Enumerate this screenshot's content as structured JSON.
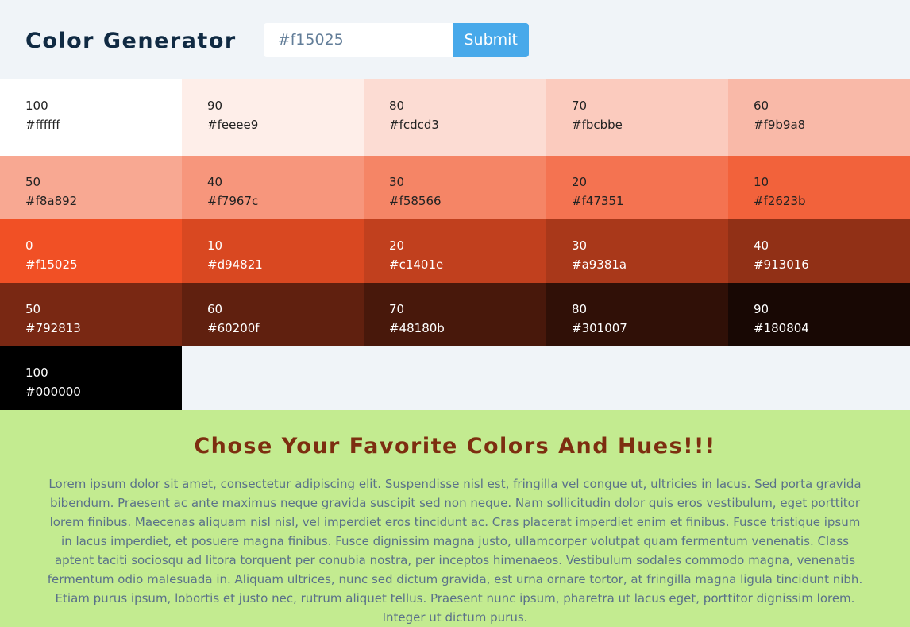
{
  "header": {
    "title": "Color Generator",
    "input_value": "#f15025",
    "input_placeholder": "#f15025",
    "submit_label": "Submit"
  },
  "colors": {
    "accent_button": "#48a9ea",
    "page_background": "#f0f4f8",
    "section_background": "#c3eb90",
    "heading_color": "#7d2e10"
  },
  "swatches": [
    {
      "weight": "100",
      "hex": "#ffffff"
    },
    {
      "weight": "90",
      "hex": "#feeee9"
    },
    {
      "weight": "80",
      "hex": "#fcdcd3"
    },
    {
      "weight": "70",
      "hex": "#fbcbbe"
    },
    {
      "weight": "60",
      "hex": "#f9b9a8"
    },
    {
      "weight": "50",
      "hex": "#f8a892"
    },
    {
      "weight": "40",
      "hex": "#f7967c"
    },
    {
      "weight": "30",
      "hex": "#f58566"
    },
    {
      "weight": "20",
      "hex": "#f47351"
    },
    {
      "weight": "10",
      "hex": "#f2623b"
    },
    {
      "weight": "0",
      "hex": "#f15025"
    },
    {
      "weight": "10",
      "hex": "#d94821"
    },
    {
      "weight": "20",
      "hex": "#c1401e"
    },
    {
      "weight": "30",
      "hex": "#a9381a"
    },
    {
      "weight": "40",
      "hex": "#913016"
    },
    {
      "weight": "50",
      "hex": "#792813"
    },
    {
      "weight": "60",
      "hex": "#60200f"
    },
    {
      "weight": "70",
      "hex": "#48180b"
    },
    {
      "weight": "80",
      "hex": "#301007"
    },
    {
      "weight": "90",
      "hex": "#180804"
    },
    {
      "weight": "100",
      "hex": "#000000"
    }
  ],
  "section": {
    "heading": "Chose Your Favorite Colors And Hues!!!",
    "body": "Lorem ipsum dolor sit amet, consectetur adipiscing elit. Suspendisse nisl est, fringilla vel congue ut, ultricies in lacus. Sed porta gravida bibendum. Praesent ac ante maximus neque gravida suscipit sed non neque. Nam sollicitudin dolor quis eros vestibulum, eget porttitor lorem finibus. Maecenas aliquam nisl nisl, vel imperdiet eros tincidunt ac. Cras placerat imperdiet enim et finibus. Fusce tristique ipsum in lacus imperdiet, et posuere magna finibus. Fusce dignissim magna justo, ullamcorper volutpat quam fermentum venenatis. Class aptent taciti sociosqu ad litora torquent per conubia nostra, per inceptos himenaeos. Vestibulum sodales commodo magna, venenatis fermentum odio malesuada in. Aliquam ultrices, nunc sed dictum gravida, est urna ornare tortor, at fringilla magna ligula tincidunt nibh. Etiam purus ipsum, lobortis et justo nec, rutrum aliquet tellus. Praesent nunc ipsum, pharetra ut lacus eget, porttitor dignissim lorem. Integer ut dictum purus."
  }
}
